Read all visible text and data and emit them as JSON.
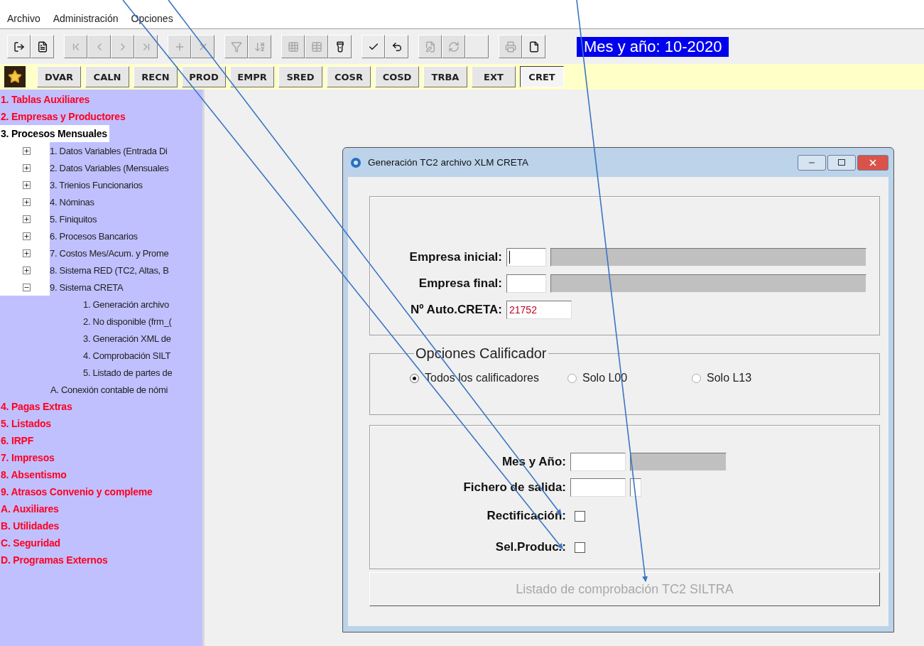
{
  "menu": [
    {
      "label": "Archivo"
    },
    {
      "label": "Administración"
    },
    {
      "label": "Opciones"
    }
  ],
  "toolbar": {
    "groups": [
      [
        {
          "kind": "exit",
          "disabled": false
        },
        {
          "kind": "form",
          "disabled": false
        }
      ],
      [
        {
          "kind": "first",
          "disabled": true
        },
        {
          "kind": "prev",
          "disabled": true
        },
        {
          "kind": "next",
          "disabled": true
        },
        {
          "kind": "last",
          "disabled": true
        }
      ],
      [
        {
          "kind": "add",
          "disabled": true
        },
        {
          "kind": "delete",
          "disabled": true
        }
      ],
      [
        {
          "kind": "filter",
          "disabled": true
        },
        {
          "kind": "sort",
          "disabled": true
        }
      ],
      [
        {
          "kind": "grid",
          "disabled": true
        },
        {
          "kind": "table",
          "disabled": true
        },
        {
          "kind": "flashlight",
          "disabled": false
        }
      ],
      [
        {
          "kind": "accept",
          "disabled": false
        },
        {
          "kind": "undo",
          "disabled": false
        }
      ],
      [
        {
          "kind": "edit",
          "disabled": true
        },
        {
          "kind": "refresh",
          "disabled": true
        },
        {
          "kind": "blank"
        }
      ],
      [
        {
          "kind": "print",
          "disabled": true
        },
        {
          "kind": "document",
          "disabled": false
        }
      ]
    ],
    "period": "Mes y año: 10-2020"
  },
  "shortcuts": [
    {
      "label": "DVAR",
      "selected": false
    },
    {
      "label": "CALN",
      "selected": false
    },
    {
      "label": "RECN",
      "selected": false
    },
    {
      "label": "PROD",
      "selected": false
    },
    {
      "label": "EMPR",
      "selected": false
    },
    {
      "label": "SRED",
      "selected": false
    },
    {
      "label": "COSR",
      "selected": false
    },
    {
      "label": "COSD",
      "selected": false
    },
    {
      "label": "TRBA",
      "selected": false
    },
    {
      "label": "EXT",
      "selected": false
    },
    {
      "label": "CRET",
      "selected": true
    }
  ],
  "sidebar": {
    "items": [
      {
        "label": "1. Tablas Auxiliares",
        "selected": false
      },
      {
        "label": "2. Empresas y Productores",
        "selected": false
      },
      {
        "label": "3. Procesos Mensuales",
        "selected": true,
        "children": [
          {
            "kind": "folder",
            "label": "1. Datos Variables (Entrada Di",
            "expanded": false
          },
          {
            "kind": "folder",
            "label": "2. Datos Variables (Mensuales",
            "expanded": false
          },
          {
            "kind": "folder",
            "label": "3. Trienios Funcionarios",
            "expanded": false
          },
          {
            "kind": "folder",
            "label": "4. Nóminas",
            "expanded": false
          },
          {
            "kind": "folder",
            "label": "5. Finiquitos",
            "expanded": false
          },
          {
            "kind": "folder",
            "label": "6. Procesos Bancarios",
            "expanded": false
          },
          {
            "kind": "folder",
            "label": "7. Costos Mes/Acum. y Prome",
            "expanded": false
          },
          {
            "kind": "folder",
            "label": "8. Sistema RED (TC2, Altas, B",
            "expanded": false
          },
          {
            "kind": "folder",
            "label": "9. Sistema CRETA",
            "expanded": true,
            "children": [
              {
                "kind": "leaf",
                "label": "1. Generación archivo"
              },
              {
                "kind": "leaf",
                "label": "2. No disponible (frm_("
              },
              {
                "kind": "leaf",
                "label": "3. Generación XML de"
              },
              {
                "kind": "leaf",
                "label": "4. Comprobación SILT"
              },
              {
                "kind": "leaf",
                "label": "5. Listado de partes de"
              }
            ]
          },
          {
            "kind": "leaf",
            "label": "A. Conexión contable de nómi"
          }
        ]
      },
      {
        "label": "4. Pagas Extras",
        "selected": false
      },
      {
        "label": "5. Listados",
        "selected": false
      },
      {
        "label": "6. IRPF",
        "selected": false
      },
      {
        "label": "7. Impresos",
        "selected": false
      },
      {
        "label": "8. Absentismo",
        "selected": false
      },
      {
        "label": "9. Atrasos Convenio y compleme",
        "selected": false
      },
      {
        "label": "A. Auxiliares",
        "selected": false
      },
      {
        "label": "B. Utilidades",
        "selected": false
      },
      {
        "label": "C. Seguridad",
        "selected": false
      },
      {
        "label": "D. Programas Externos",
        "selected": false
      }
    ]
  },
  "dialog": {
    "title": "Generación TC2 archivo XLM CRETA",
    "company_fields": [
      {
        "label": "Empresa inicial:",
        "focused": true
      },
      {
        "label": "Empresa final:",
        "focused": false
      }
    ],
    "auth": {
      "label": "Nº Auto.CRETA:",
      "value": "21752"
    },
    "qualifier": {
      "legend": "Opciones Calificador",
      "options": [
        {
          "label": "Todos los calificadores",
          "selected": true
        },
        {
          "label": "Solo L00",
          "selected": false
        },
        {
          "label": "Solo L13",
          "selected": false
        }
      ]
    },
    "period_fields": [
      {
        "kind": "month",
        "label": "Mes y Año:"
      },
      {
        "kind": "file",
        "label": "Fichero de salida:"
      }
    ],
    "checks": [
      {
        "label": "Rectificación:",
        "checked": false
      },
      {
        "label": "Sel.Produc.:",
        "checked": false
      }
    ],
    "action": {
      "label": "Listado de comprobación TC2 SILTRA",
      "disabled": true
    }
  }
}
